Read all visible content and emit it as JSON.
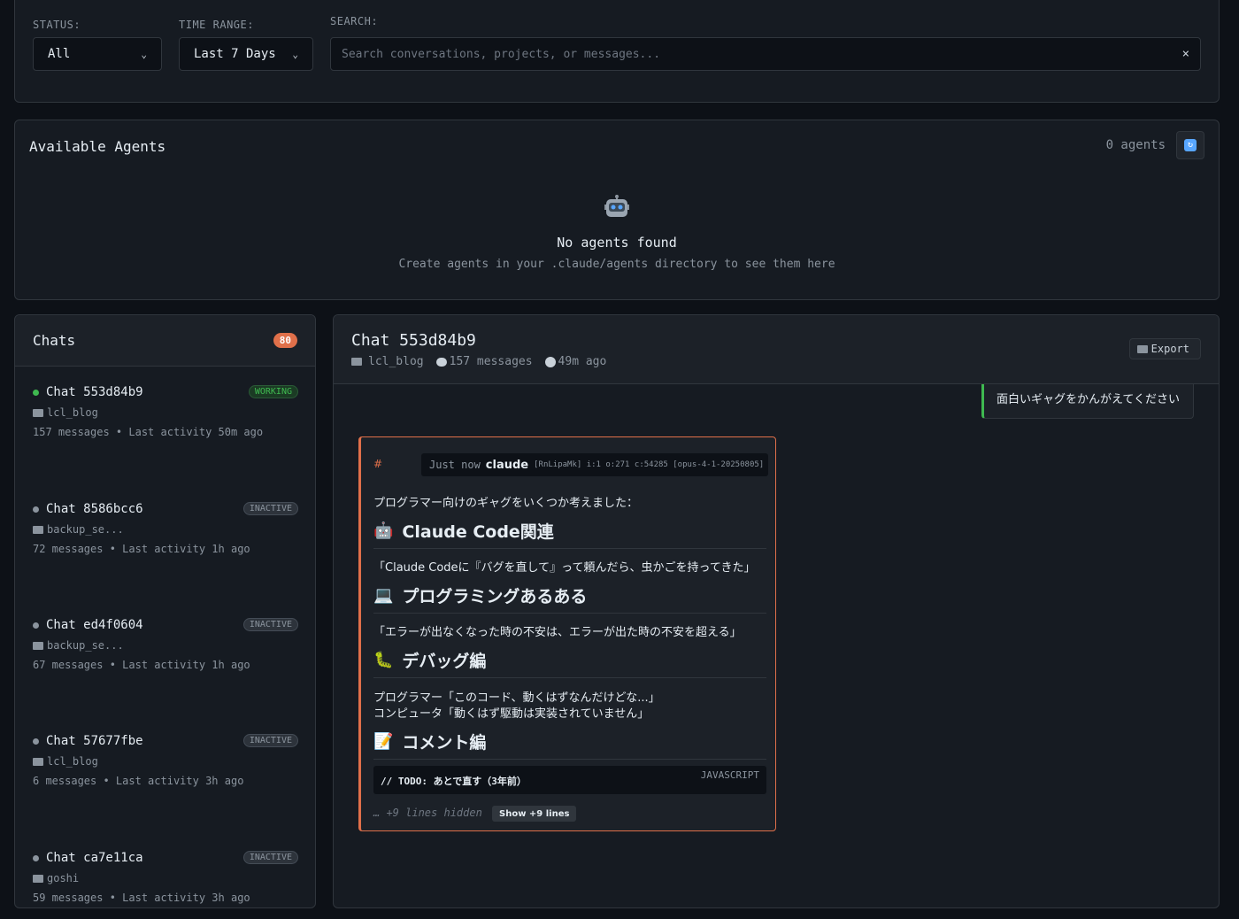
{
  "filters": {
    "status_label": "STATUS:",
    "status_value": "All",
    "time_label": "TIME RANGE:",
    "time_value": "Last 7 Days",
    "search_label": "SEARCH:",
    "search_placeholder": "Search conversations, projects, or messages...",
    "clear_glyph": "×"
  },
  "agents": {
    "title": "Available Agents",
    "count": "0 agents",
    "empty_title": "No agents found",
    "empty_subtitle": "Create agents in your .claude/agents directory to see them here"
  },
  "chats": {
    "title": "Chats",
    "count": "80",
    "items": [
      {
        "name": "Chat 553d84b9",
        "state": "WORKING",
        "project": "lcl_blog",
        "meta": "157 messages • Last activity 50m ago"
      },
      {
        "name": "Chat 8586bcc6",
        "state": "INACTIVE",
        "project": "backup_se...",
        "meta": "72 messages • Last activity 1h ago"
      },
      {
        "name": "Chat ed4f0604",
        "state": "INACTIVE",
        "project": "backup_se...",
        "meta": "67 messages • Last activity 1h ago"
      },
      {
        "name": "Chat 57677fbe",
        "state": "INACTIVE",
        "project": "lcl_blog",
        "meta": "6 messages • Last activity 3h ago"
      },
      {
        "name": "Chat ca7e11ca",
        "state": "INACTIVE",
        "project": "goshi",
        "meta": "59 messages • Last activity 3h ago"
      }
    ]
  },
  "detail": {
    "title": "Chat 553d84b9",
    "project": "lcl_blog",
    "messages": "157 messages",
    "time": "49m ago",
    "export_label": "Export",
    "user_message": "面白いギャグをかんがえてください",
    "assistant": {
      "hash": "#",
      "time": "Just now",
      "author": "claude",
      "tech": "[RnLipaMk] i:1 o:271 c:54285 [opus-4-1-20250805]",
      "intro": "プログラマー向けのギャグをいくつか考えました：",
      "h1": "Claude Code関連",
      "p1": "「Claude Codeに『バグを直して』って頼んだら、虫かごを持ってきた」",
      "h2": "プログラミングあるある",
      "p2": "「エラーが出なくなった時の不安は、エラーが出た時の不安を超える」",
      "h3": "デバッグ編",
      "p3a": "プログラマー「このコード、動くはずなんだけどな...」",
      "p3b": "コンピュータ「動くはず駆動は実装されていません」",
      "h4": "コメント編",
      "code": "// TODO: あとで直す（3年前）",
      "code_lang": "JAVASCRIPT",
      "hidden_note": "… +9 lines hidden",
      "show_label": "Show +9 lines"
    }
  }
}
